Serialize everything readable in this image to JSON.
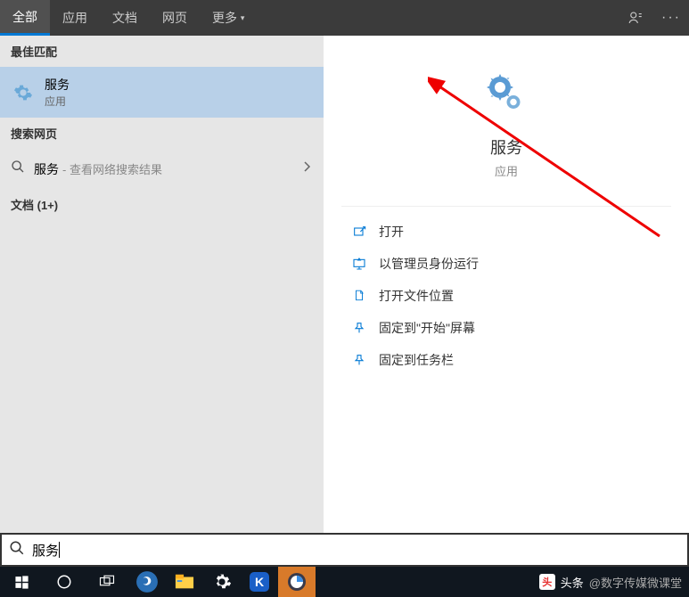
{
  "tabs": {
    "items": [
      "全部",
      "应用",
      "文档",
      "网页",
      "更多"
    ],
    "active_index": 0,
    "more_indicator": "▾"
  },
  "sections": {
    "best_match": "最佳匹配",
    "search_web": "搜索网页",
    "documents": "文档 (1+)"
  },
  "result": {
    "title": "服务",
    "subtitle": "应用"
  },
  "web_search": {
    "query": "服务",
    "hint": "- 查看网络搜索结果"
  },
  "preview": {
    "title": "服务",
    "subtitle": "应用"
  },
  "actions": [
    {
      "label": "打开",
      "icon": "open"
    },
    {
      "label": "以管理员身份运行",
      "icon": "admin"
    },
    {
      "label": "打开文件位置",
      "icon": "folder"
    },
    {
      "label": "固定到\"开始\"屏幕",
      "icon": "pin"
    },
    {
      "label": "固定到任务栏",
      "icon": "pin"
    }
  ],
  "searchbox": {
    "value": "服务"
  },
  "watermark": {
    "prefix": "头条",
    "text": "@数字传媒微课堂"
  }
}
